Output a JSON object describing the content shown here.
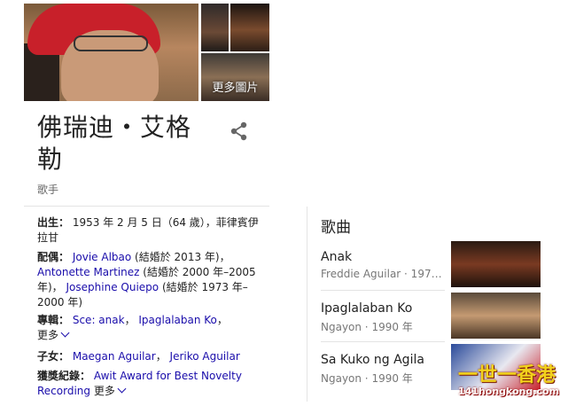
{
  "panel": {
    "more_images_label": "更多圖片",
    "title": "佛瑞迪・艾格勒",
    "subtitle": "歌手"
  },
  "facts": {
    "born_label": "出生：",
    "born_value": "1953 年 2 月 5 日（64 歲），菲律賓伊拉甘",
    "spouse_label": "配偶：",
    "spouse_1_name": "Jovie Albao",
    "spouse_1_note": "(結婚於 2013 年)，",
    "spouse_2_name": "Antonette Martinez",
    "spouse_2_note": "(結婚於 2000 年–2005 年)，",
    "spouse_3_name": "Josephine Quiepo",
    "spouse_3_note": "(結婚於 1973 年–2000 年)",
    "albums_label": "專輯：",
    "album_1": "Sce: anak",
    "album_2": "Ipaglalaban Ko",
    "albums_more": "更多",
    "children_label": "子女：",
    "child_1": "Maegan Aguilar",
    "child_2": "Jeriko Aguilar",
    "awards_label": "獲獎紀錄：",
    "award_1": "Awit Award for Best Novelty Recording",
    "awards_more": "更多"
  },
  "songs": {
    "title": "歌曲",
    "items": [
      {
        "name": "Anak",
        "meta": "Freddie Aguilar · 197…"
      },
      {
        "name": "Ipaglalaban Ko",
        "meta": "Ngayon · 1990 年"
      },
      {
        "name": "Sa Kuko ng Agila",
        "meta": "Ngayon · 1990 年"
      }
    ]
  },
  "watermark": {
    "line1": "一世一香港",
    "line2": "141hongkong.com"
  },
  "colors": {
    "link": "#1a0dab",
    "hat": "#c8202a"
  }
}
